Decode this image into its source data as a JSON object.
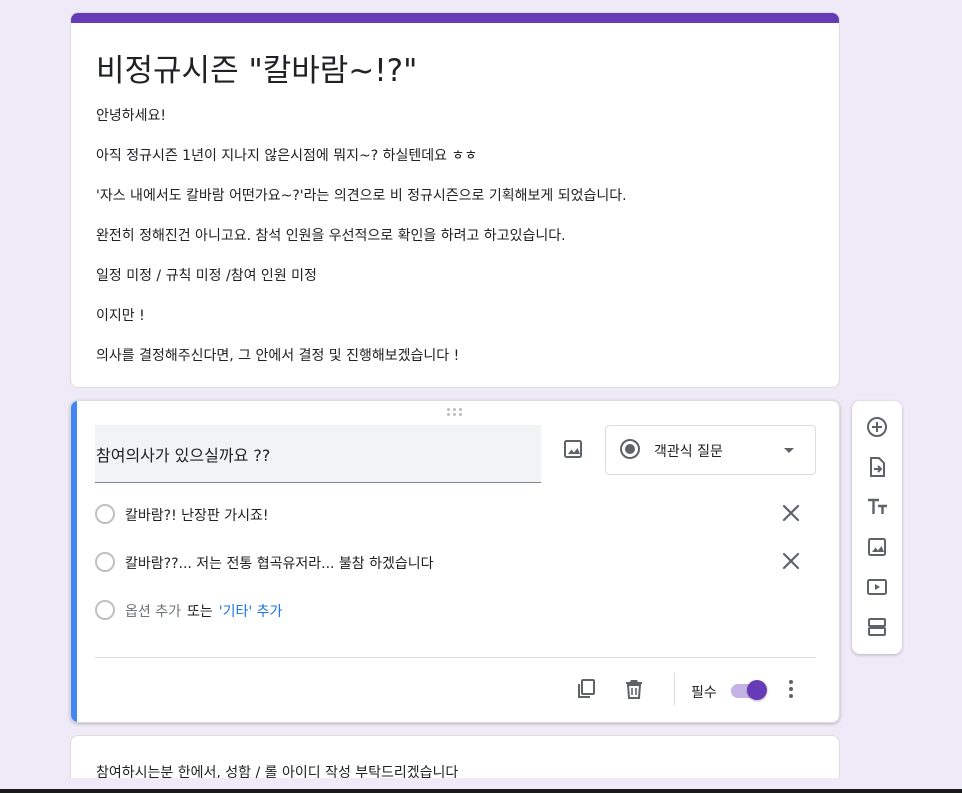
{
  "form": {
    "title": "비정규시즌 \"칼바람~!?\"",
    "description": [
      "안녕하세요!",
      "아직 정규시즌 1년이 지나지 않은시점에 뭐지~? 하실텐데요 ㅎㅎ",
      "'자스 내에서도 칼바람 어떤가요~?'라는 의견으로 비 정규시즌으로 기획해보게 되었습니다.",
      "완전히 정해진건 아니고요. 참석 인원을 우선적으로 확인을 하려고 하고있습니다.",
      "일정 미정 / 규칙 미정 /참여 인원 미정",
      "이지만 !",
      "의사를 결정해주신다면, 그 안에서 결정 및 진행해보겠습니다 !"
    ],
    "accent_color": "#673ab7",
    "background_color": "#efeaf8"
  },
  "question": {
    "title": "참여의사가 있으실까요 ??",
    "type_label": "객관식 질문",
    "options": [
      "칼바람?! 난장판 가시죠!",
      "칼바람??... 저는 전통 협곡유저라... 불참 하겠습니다"
    ],
    "add_option_label": "옵션 추가",
    "or_label": "또는",
    "add_other_label": "'기타' 추가",
    "required_label": "필수",
    "required": true,
    "active_bar_color": "#4285f4"
  },
  "side_toolbar": {
    "icons": [
      "add-question-icon",
      "import-questions-icon",
      "add-title-icon",
      "add-image-icon",
      "add-video-icon",
      "add-section-icon"
    ]
  },
  "next_question": {
    "title": "참여하시는분 한에서, 성함 / 롤 아이디 작성 부탁드리겠습니다"
  }
}
